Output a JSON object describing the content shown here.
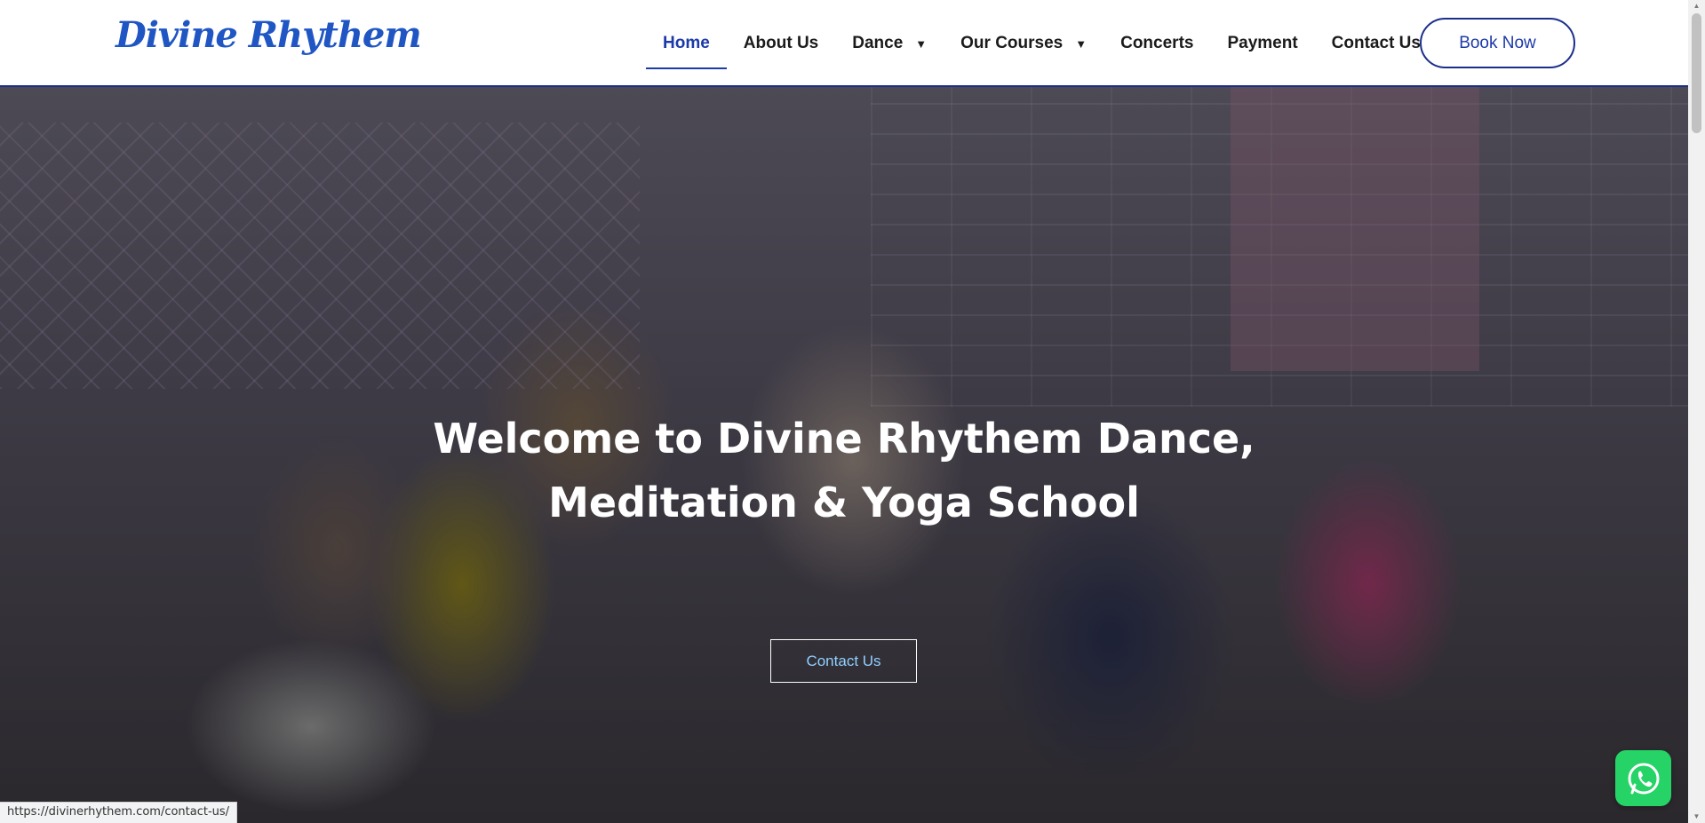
{
  "header": {
    "logo": "Divine Rhythem",
    "nav": [
      {
        "label": "Home",
        "active": true,
        "dropdown": false
      },
      {
        "label": "About Us",
        "active": false,
        "dropdown": false
      },
      {
        "label": "Dance",
        "active": false,
        "dropdown": true
      },
      {
        "label": "Our Courses",
        "active": false,
        "dropdown": true
      },
      {
        "label": "Concerts",
        "active": false,
        "dropdown": false
      },
      {
        "label": "Payment",
        "active": false,
        "dropdown": false
      },
      {
        "label": "Contact Us",
        "active": false,
        "dropdown": false
      }
    ],
    "book_button": "Book Now"
  },
  "hero": {
    "title": "Welcome to Divine Rhythem Dance, Meditation & Yoga School",
    "button": "Contact Us",
    "image": "group-photo"
  },
  "status_url": "https://divinerhythem.com/contact-us/",
  "widgets": {
    "whatsapp_icon": "whatsapp-icon"
  },
  "colors": {
    "brand_blue": "#1c3aa9",
    "logo_blue": "#1f56c4",
    "whatsapp_green": "#25d366"
  }
}
